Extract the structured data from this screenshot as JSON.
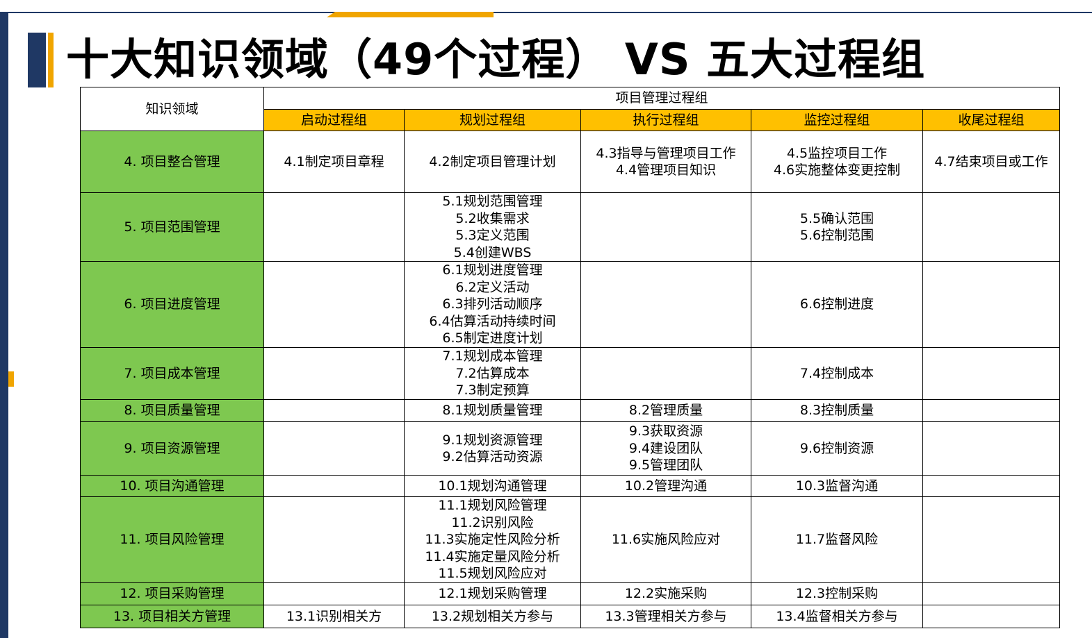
{
  "title": "十大知识领域（49个过程） VS 五大过程组",
  "table": {
    "corner_header": "知识领域",
    "group_header": "项目管理过程组",
    "columns": [
      "启动过程组",
      "规划过程组",
      "执行过程组",
      "监控过程组",
      "收尾过程组"
    ],
    "rows": [
      {
        "area": "4. 项目整合管理",
        "cells": [
          [
            "4.1制定项目章程"
          ],
          [
            "4.2制定项目管理计划"
          ],
          [
            "4.3指导与管理项目工作",
            "4.4管理项目知识"
          ],
          [
            "4.5监控项目工作",
            "4.6实施整体变更控制"
          ],
          [
            "4.7结束项目或工作"
          ]
        ]
      },
      {
        "area": "5. 项目范围管理",
        "cells": [
          [],
          [
            "5.1规划范围管理",
            "5.2收集需求",
            "5.3定义范围",
            "5.4创建WBS"
          ],
          [],
          [
            "5.5确认范围",
            "5.6控制范围"
          ],
          []
        ]
      },
      {
        "area": "6. 项目进度管理",
        "cells": [
          [],
          [
            "6.1规划进度管理",
            "6.2定义活动",
            "6.3排列活动顺序",
            "6.4估算活动持续时间",
            "6.5制定进度计划"
          ],
          [],
          [
            "6.6控制进度"
          ],
          []
        ]
      },
      {
        "area": "7. 项目成本管理",
        "cells": [
          [],
          [
            "7.1规划成本管理",
            "7.2估算成本",
            "7.3制定预算"
          ],
          [],
          [
            "7.4控制成本"
          ],
          []
        ]
      },
      {
        "area": "8. 项目质量管理",
        "cells": [
          [],
          [
            "8.1规划质量管理"
          ],
          [
            "8.2管理质量"
          ],
          [
            "8.3控制质量"
          ],
          []
        ]
      },
      {
        "area": "9. 项目资源管理",
        "cells": [
          [],
          [
            "9.1规划资源管理",
            "9.2估算活动资源"
          ],
          [
            "9.3获取资源",
            "9.4建设团队",
            "9.5管理团队"
          ],
          [
            "9.6控制资源"
          ],
          []
        ]
      },
      {
        "area": "10. 项目沟通管理",
        "cells": [
          [],
          [
            "10.1规划沟通管理"
          ],
          [
            "10.2管理沟通"
          ],
          [
            "10.3监督沟通"
          ],
          []
        ]
      },
      {
        "area": "11. 项目风险管理",
        "cells": [
          [],
          [
            "11.1规划风险管理",
            "11.2识别风险",
            "11.3实施定性风险分析",
            "11.4实施定量风险分析",
            "11.5规划风险应对"
          ],
          [
            "11.6实施风险应对"
          ],
          [
            "11.7监督风险"
          ],
          []
        ]
      },
      {
        "area": "12. 项目采购管理",
        "cells": [
          [],
          [
            "12.1规划采购管理"
          ],
          [
            "12.2实施采购"
          ],
          [
            "12.3控制采购"
          ],
          []
        ]
      },
      {
        "area": "13. 项目相关方管理",
        "cells": [
          [
            "13.1识别相关方"
          ],
          [
            "13.2规划相关方参与"
          ],
          [
            "13.3管理相关方参与"
          ],
          [
            "13.4监督相关方参与"
          ],
          []
        ]
      }
    ]
  },
  "colors": {
    "area_fill": "#7ec850",
    "header_fill": "#ffc000",
    "title_bar_blue": "#1f3864",
    "title_bar_gold": "#f0a500"
  }
}
